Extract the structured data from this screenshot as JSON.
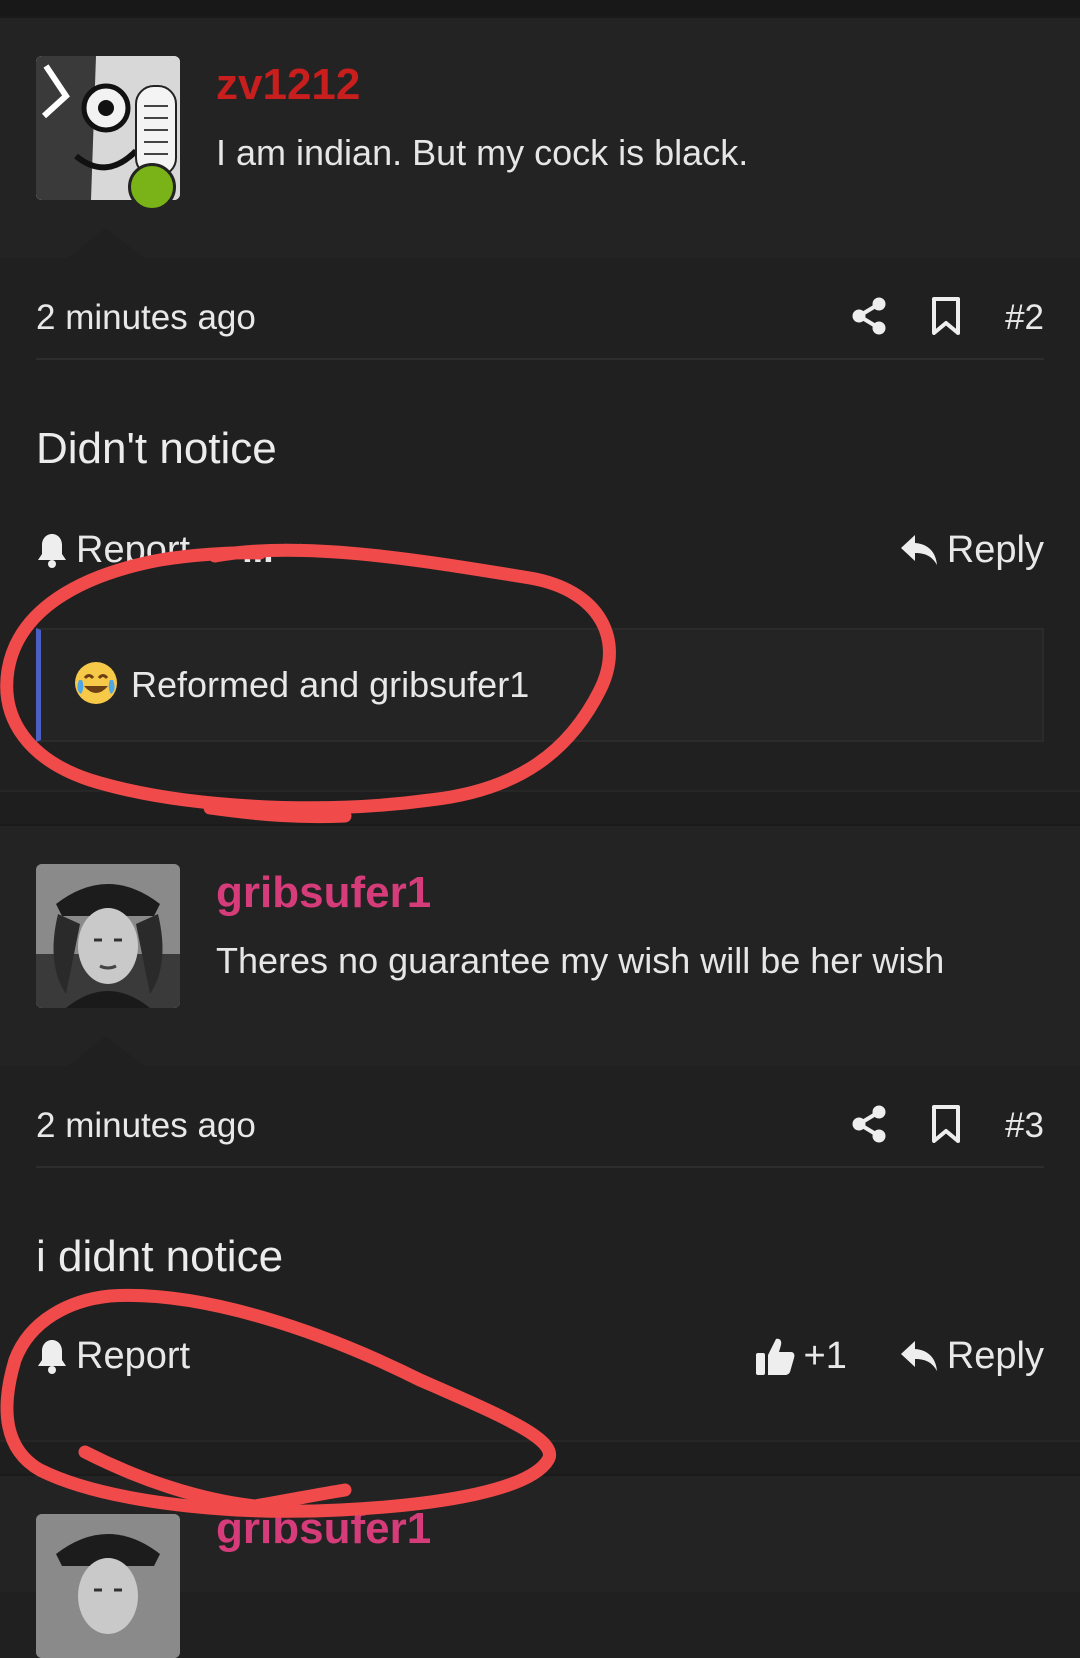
{
  "posts": [
    {
      "username": "zv1212",
      "username_color": "#c81e1e",
      "signature": "I am indian. But my cock is black.",
      "time": "2 minutes ago",
      "post_number": "#2",
      "body": "Didn't notice",
      "report_label": "Report",
      "more_label": "...",
      "reply_label": "Reply",
      "reactions_text": "Reformed and gribsufer1",
      "reaction_icon": "crying-laughing-emoji",
      "online": true
    },
    {
      "username": "gribsufer1",
      "username_color": "#d63c7a",
      "signature": "Theres no guarantee my wish will be her wish",
      "time": "2 minutes ago",
      "post_number": "#3",
      "body": "i didnt notice",
      "report_label": "Report",
      "like_count": "+1",
      "reply_label": "Reply"
    },
    {
      "username": "gribsufer1",
      "username_color": "#d63c7a"
    }
  ],
  "colors": {
    "background": "#202020",
    "accent_bar": "#4a5fc1",
    "annotation": "#f04a4a"
  }
}
